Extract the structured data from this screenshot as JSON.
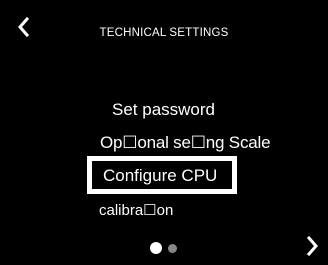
{
  "header": {
    "title": "TECHNICAL SETTINGS",
    "back_icon": "chevron-left-icon",
    "next_icon": "chevron-right-icon"
  },
  "menu": {
    "items": [
      {
        "label": "Set password"
      },
      {
        "label": "Op☐onal se☐ng  Scale"
      },
      {
        "label": "Configure CPU",
        "selected": true
      },
      {
        "label": "calibra☐on"
      }
    ]
  },
  "pager": {
    "pages": 2,
    "current": 1
  },
  "colors": {
    "background": "#000000",
    "text": "#ffffff",
    "dot_active": "#ffffff",
    "dot_inactive": "#888888"
  }
}
